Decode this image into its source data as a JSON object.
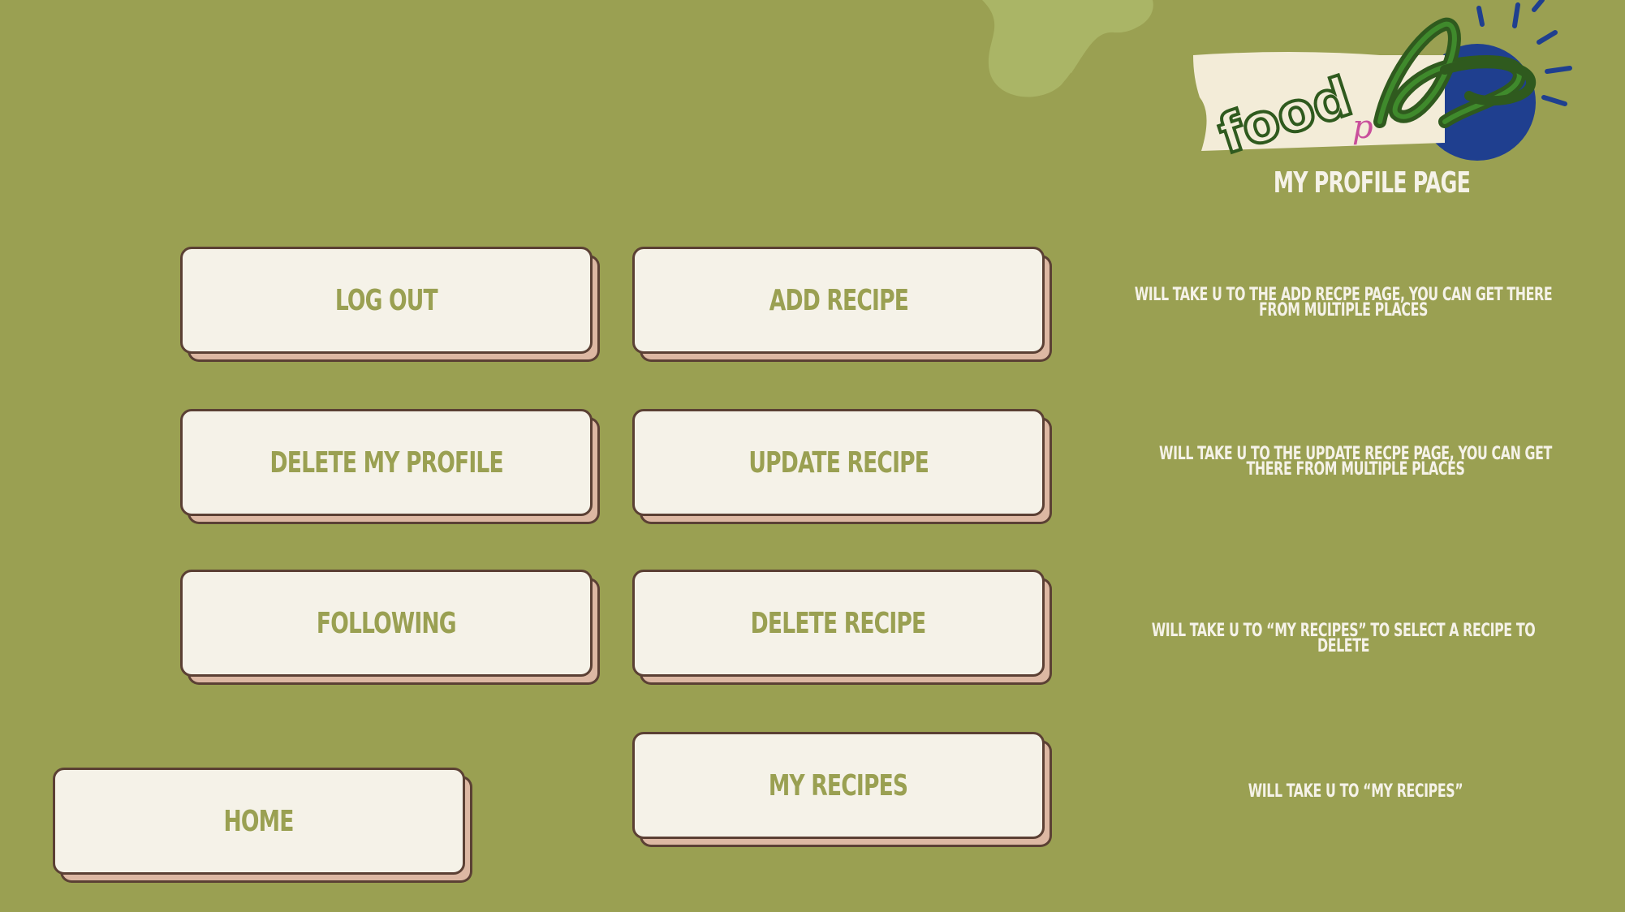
{
  "logo": {
    "text": "foodpApps"
  },
  "page_title": "MY PROFILE PAGE",
  "buttons": {
    "log_out": "LOG OUT",
    "add_recipe": "ADD RECIPE",
    "delete_my_profile": "DELETE MY PROFILE",
    "update_recipe": "UPDATE RECIPE",
    "following": "FOLLOWING",
    "delete_recipe": "DELETE RECIPE",
    "home": "HOME",
    "my_recipes": "MY RECIPES"
  },
  "notes": {
    "add_recipe": "WILL TAKE U TO THE ADD RECPE PAGE, YOU CAN GET THERE FROM MULTIPLE PLACES",
    "update_recipe": "WILL TAKE U TO THE UPDATE RECPE PAGE, YOU CAN GET THERE FROM MULTIPLE PLACES",
    "delete_recipe": "WILL TAKE U TO “MY RECIPES” TO SELECT A RECIPE TO DELETE",
    "my_recipes": "WILL TAKE U TO “MY RECIPES”"
  },
  "colors": {
    "background": "#9aa052",
    "button_face": "#f5f2e8",
    "button_border": "#5b4034",
    "button_shadow": "#ddb8a3",
    "logo_blue": "#1f3f8f",
    "logo_green": "#2f5a1e"
  }
}
